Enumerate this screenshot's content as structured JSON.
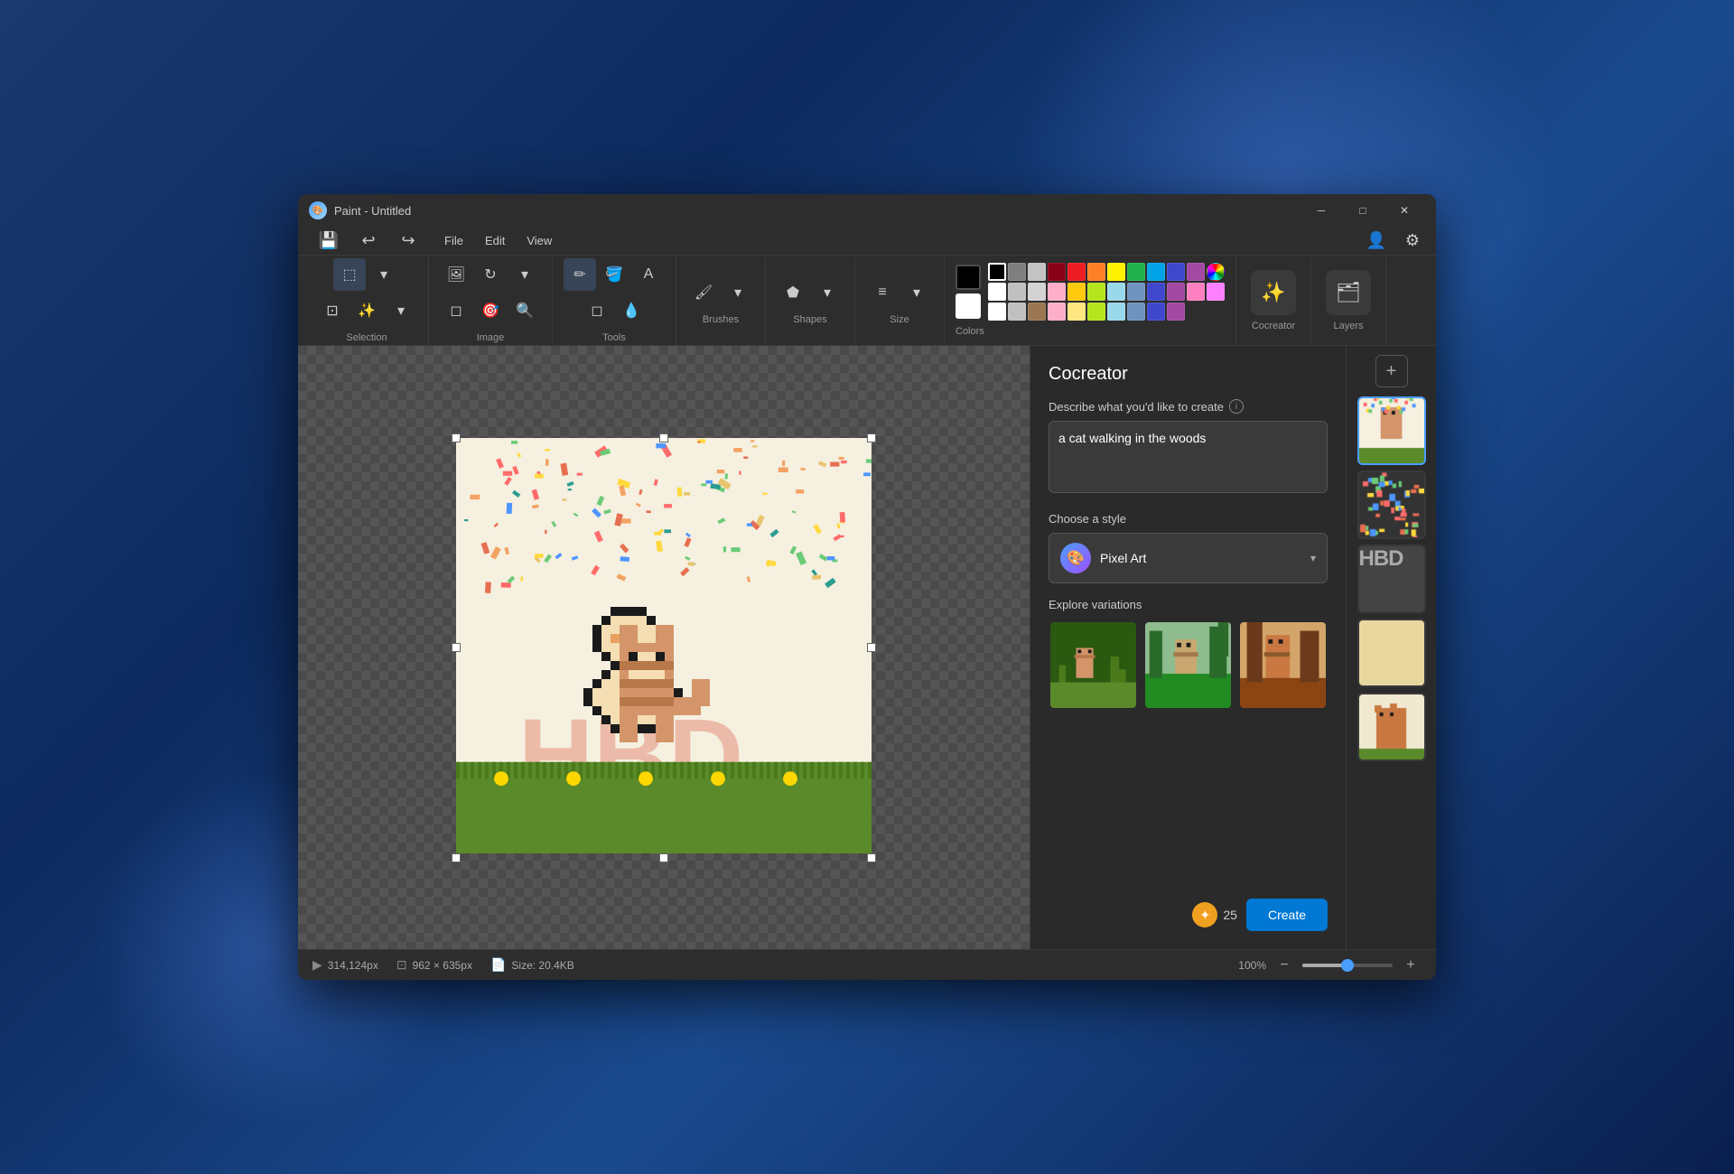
{
  "window": {
    "title": "Paint - Untitled",
    "icon": "🎨"
  },
  "titlebar": {
    "minimize_label": "─",
    "maximize_label": "□",
    "close_label": "✕"
  },
  "menubar": {
    "items": [
      {
        "id": "file",
        "label": "File"
      },
      {
        "id": "edit",
        "label": "Edit"
      },
      {
        "id": "view",
        "label": "View"
      }
    ]
  },
  "toolbar": {
    "undo_label": "↩",
    "redo_label": "↪",
    "save_label": "💾",
    "account_label": "👤",
    "settings_label": "⚙"
  },
  "sections": {
    "selection_label": "Selection",
    "image_label": "Image",
    "tools_label": "Tools",
    "brushes_label": "Brushes",
    "shapes_label": "Shapes",
    "size_label": "Size",
    "colors_label": "Colors",
    "cocreator_label": "Cocreator",
    "layers_label": "Layers"
  },
  "colors": {
    "current_fg": "#000000",
    "current_bg": "#ffffff",
    "palette_row1": [
      "#000000",
      "#7f7f7f",
      "#c0c0c0",
      "#ff0000",
      "#ff6600",
      "#ffff00",
      "#00ff00",
      "#00ffff",
      "#0000ff",
      "#7f00ff",
      "#ff00ff",
      "#ff007f"
    ],
    "palette_row2": [
      "#ffffff",
      "#c0c0c0",
      "#9b7653",
      "#ffaec9",
      "#ffe680",
      "#b5e61d",
      "#99d9ea",
      "#7092be",
      "#3f48cc",
      "#a349a4",
      "#ff80c0",
      "#ff80ff"
    ],
    "palette_row3": [
      "#ffffff",
      "#c0c0c0",
      "#9b7653",
      "#ffaec9",
      "#ffe680",
      "#b5e61d",
      "#99d9ea",
      "#7092be",
      "#3f48cc",
      "#a349a4"
    ],
    "rainbow": "🌈"
  },
  "cocreator": {
    "title": "Cocreator",
    "describe_label": "Describe what you'd like to create",
    "describe_placeholder": "a cat walking in the woods",
    "describe_value": "a cat walking in the woods",
    "style_label": "Choose a style",
    "style_name": "Pixel Art",
    "style_icon": "🎨",
    "variations_label": "Explore variations",
    "credits": "25",
    "create_label": "Create"
  },
  "layers": {
    "add_icon": "+",
    "panel_label": "Layers",
    "layer_count": 5
  },
  "statusbar": {
    "position": "314,124px",
    "dimensions": "962 × 635px",
    "file_size": "Size: 20.4KB",
    "zoom": "100%",
    "fullscreen_icon": "⛶",
    "play_icon": "▶"
  }
}
